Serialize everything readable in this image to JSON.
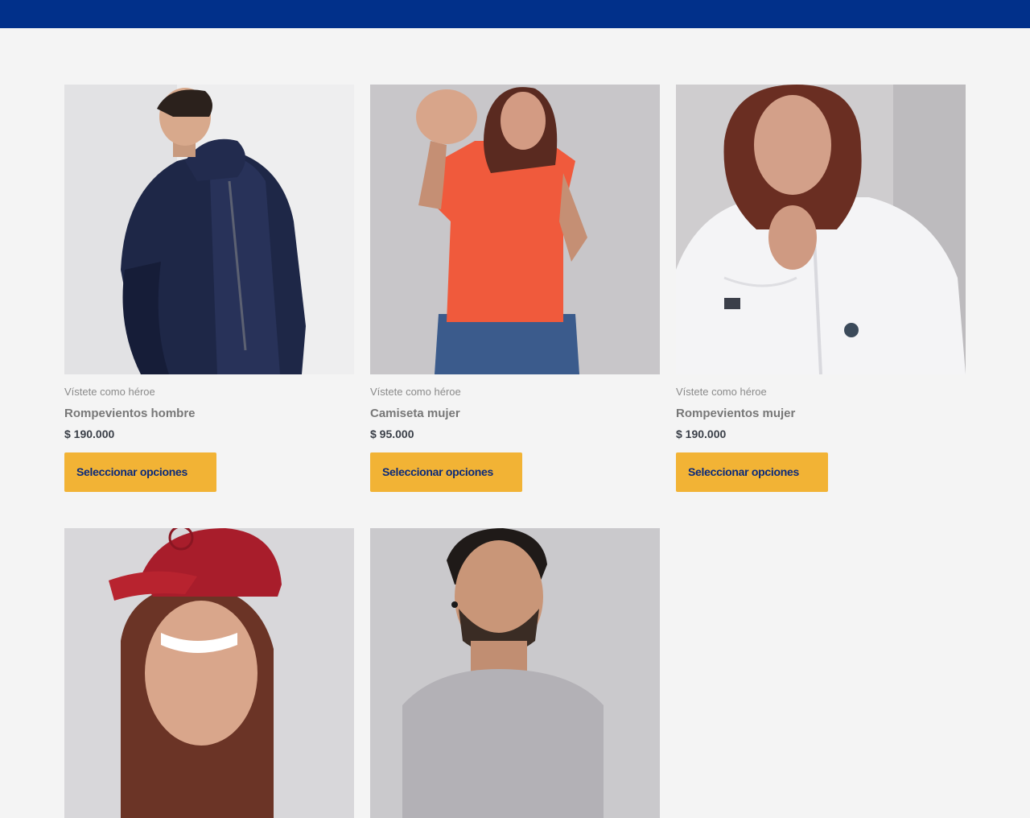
{
  "header": {
    "bar_color": "#01308a"
  },
  "products": [
    {
      "category": "Vístete como héroe",
      "title": "Rompevientos hombre",
      "price": "$ 190.000",
      "button": "Seleccionar opciones",
      "image": "man-navy-windbreaker-photo"
    },
    {
      "category": "Vístete como héroe",
      "title": "Camiseta mujer",
      "price": "$ 95.000",
      "button": "Seleccionar opciones",
      "image": "woman-orange-tshirt-photo"
    },
    {
      "category": "Vístete como héroe",
      "title": "Rompevientos mujer",
      "price": "$ 190.000",
      "button": "Seleccionar opciones",
      "image": "woman-white-windbreaker-photo"
    },
    {
      "image": "woman-red-cap-photo"
    },
    {
      "image": "man-portrait-photo"
    }
  ],
  "colors": {
    "accent_button": "#f2b335",
    "button_text": "#0b2a7a",
    "background": "#f4f4f4"
  }
}
